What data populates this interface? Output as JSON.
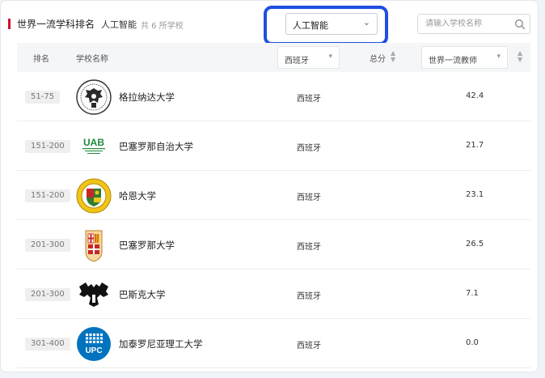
{
  "header": {
    "title": "世界一流学科排名",
    "subject": "人工智能",
    "count_text": "共 6 所学校"
  },
  "subject_select": {
    "value": "人工智能"
  },
  "search": {
    "placeholder": "请输入学校名称",
    "value": ""
  },
  "table": {
    "columns": {
      "rank": "排名",
      "school": "学校名称",
      "country_filter": "西班牙",
      "total": "总分",
      "indicator": "世界一流教师"
    },
    "rows": [
      {
        "rank": "51-75",
        "name": "格拉纳达大学",
        "country": "西班牙",
        "score": "42.4",
        "logo": "granada-seal-icon"
      },
      {
        "rank": "151-200",
        "name": "巴塞罗那自治大学",
        "country": "西班牙",
        "score": "21.7",
        "logo": "uab-logo-icon",
        "logo_text": "UAB"
      },
      {
        "rank": "151-200",
        "name": "哈恩大学",
        "country": "西班牙",
        "score": "23.1",
        "logo": "jaen-crest-icon"
      },
      {
        "rank": "201-300",
        "name": "巴塞罗那大学",
        "country": "西班牙",
        "score": "26.5",
        "logo": "barcelona-crest-icon"
      },
      {
        "rank": "201-300",
        "name": "巴斯克大学",
        "country": "西班牙",
        "score": "7.1",
        "logo": "basque-tree-icon"
      },
      {
        "rank": "301-400",
        "name": "加泰罗尼亚理工大学",
        "country": "西班牙",
        "score": "0.0",
        "logo": "upc-logo-icon",
        "logo_text": "UPC"
      }
    ]
  },
  "colors": {
    "accent": "#d0102e",
    "highlight_ring": "#1e4fe0",
    "uab_green": "#1e8a3b",
    "upc_blue": "#0073bf"
  }
}
